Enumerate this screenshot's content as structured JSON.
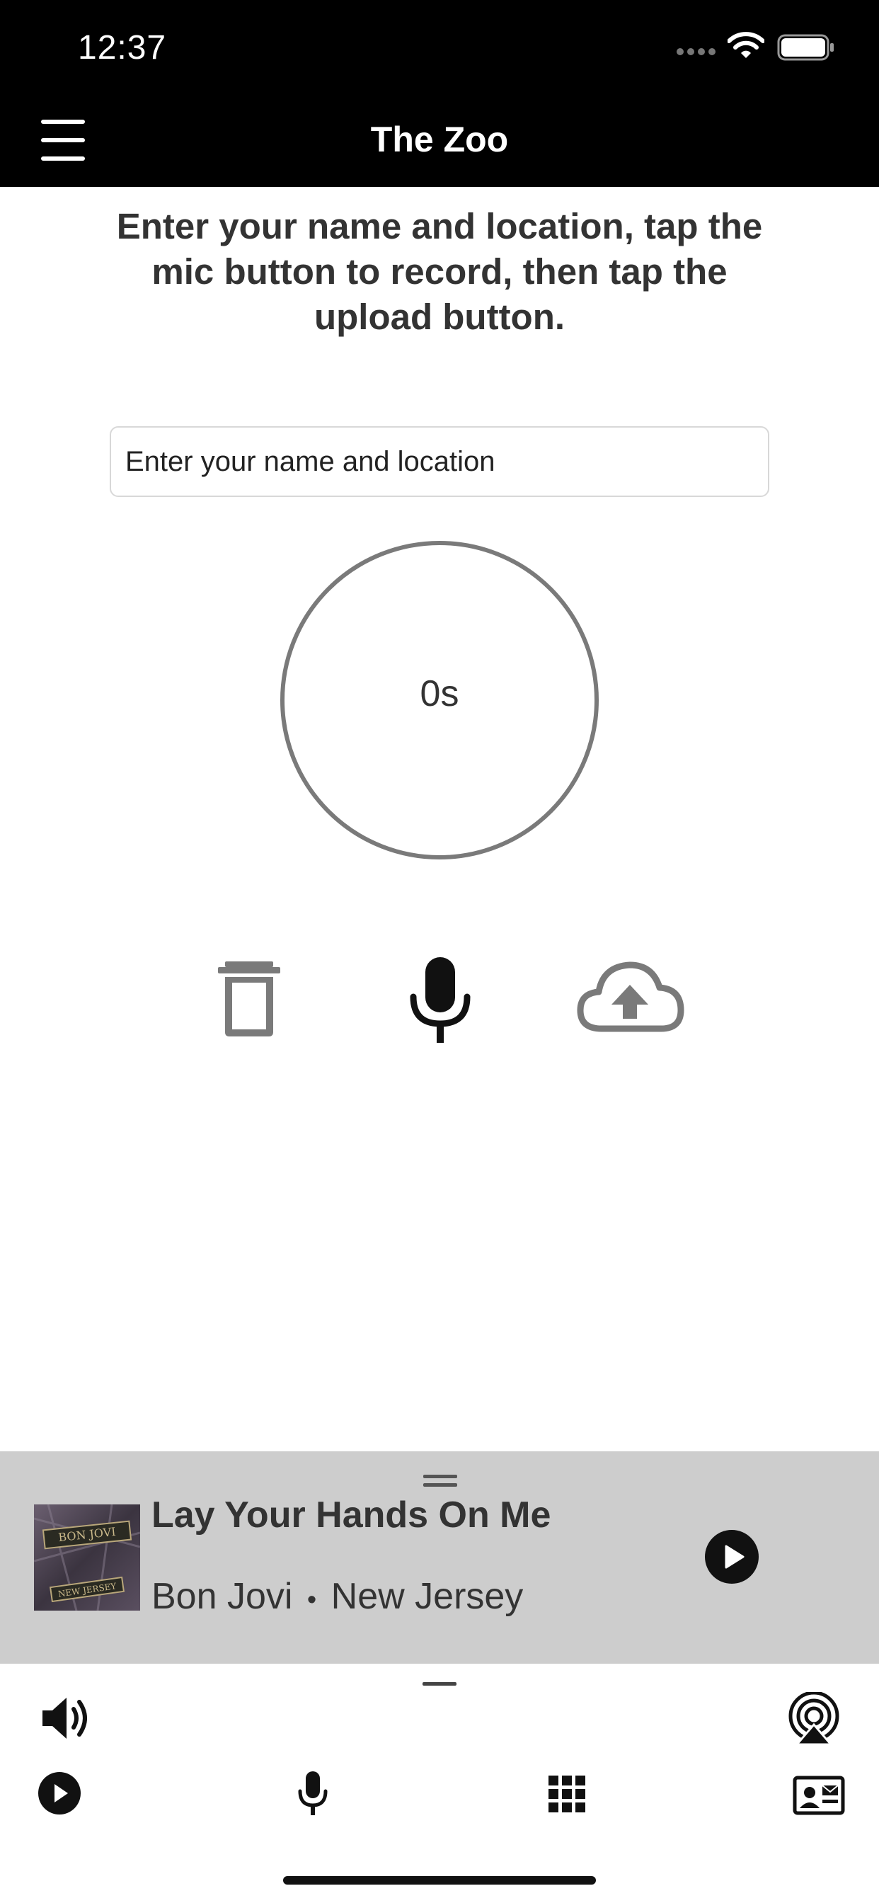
{
  "status": {
    "time": "12:37"
  },
  "nav": {
    "title": "The Zoo"
  },
  "instructions": "Enter your name and location, tap the mic button to record, then tap the upload button.",
  "name_input": {
    "placeholder": "Enter your name and location",
    "value": ""
  },
  "timer": {
    "text": "0s"
  },
  "controls": {
    "delete_icon": "trash-icon",
    "record_icon": "microphone-icon",
    "upload_icon": "cloud-upload-icon"
  },
  "now_playing": {
    "title": "Lay Your Hands On Me",
    "artist": "Bon Jovi",
    "separator": "•",
    "album": "New Jersey",
    "album_art_text_top": "BON JOVI",
    "album_art_text_bottom": "NEW JERSEY"
  },
  "bottom_bar": {
    "volume_icon": "speaker-icon",
    "airplay_icon": "airplay-icon",
    "tabs": [
      {
        "icon": "play-circle-icon"
      },
      {
        "icon": "microphone-icon"
      },
      {
        "icon": "grid-icon"
      },
      {
        "icon": "contact-card-icon"
      }
    ]
  },
  "colors": {
    "bar_bg": "#000000",
    "now_playing_bg": "#cdcdcd",
    "text": "#333333",
    "disabled_icon": "#7a7a7a"
  }
}
